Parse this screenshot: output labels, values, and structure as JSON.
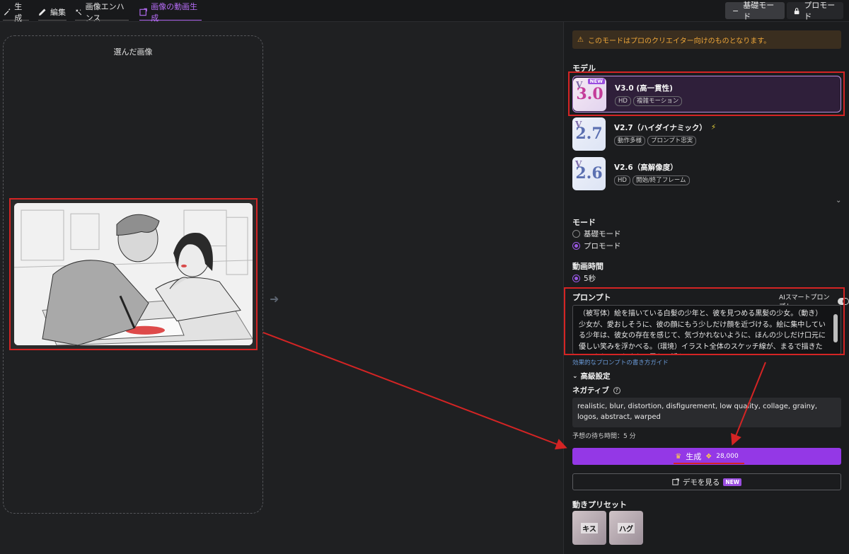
{
  "nav": {
    "tabs": [
      {
        "label": "生成",
        "icon": "brush-icon"
      },
      {
        "label": "編集",
        "icon": "pencil-icon"
      },
      {
        "label": "画像エンハンス",
        "icon": "magic-icon"
      },
      {
        "label": "画像の動画生成",
        "icon": "image-to-video-icon",
        "active": true
      }
    ],
    "mode_basic": "基礎モード",
    "mode_pro": "プロモード"
  },
  "left": {
    "title": "選んだ画像"
  },
  "right": {
    "warning": "このモードはプロのクリエイター向けのものとなります。",
    "model_label": "モデル",
    "models": [
      {
        "name": "V3.0 (高一貫性)",
        "thumb": "3.0",
        "badge": "NEW",
        "tags": [
          "HD",
          "複雑モーション"
        ],
        "selected": true
      },
      {
        "name": "V2.7（ハイダイナミック）",
        "thumb": "2.7",
        "tags": [
          "動作多様",
          "プロンプト忠実"
        ]
      },
      {
        "name": "V2.6（高解像度）",
        "thumb": "2.6",
        "tags": [
          "HD",
          "開始/終了フレーム"
        ]
      }
    ],
    "mode_label": "モード",
    "mode_options": [
      "基礎モード",
      "プロモード"
    ],
    "duration_label": "動画時間",
    "duration_value": "5秒",
    "prompt_label": "プロンプト",
    "ai_smart_prompt": "AIスマートプロンプト",
    "prompt_text": "（被写体）絵を描いている白髪の少年と、彼を見つめる黒髪の少女。（動き）少女が、愛おしそうに、彼の顔にもう少しだけ顔を近づける。絵に集中している少年は、彼女の存在を感じて、気づかれないように、ほんの少しだけ口元に優しい笑みを浮かべる。（環境）イラスト全体のスケッチ線が、まるで描きたてのように、かすかに震え、揺らぐ。",
    "prompt_guide": "効果的なプロンプトの書き方ガイド",
    "advanced": "高級設定",
    "negative_label": "ネガティブ",
    "negative_text": "realistic, blur, distortion, disfigurement, low quality, collage, grainy, logos, abstract, warped",
    "wait_time": "予想の待ち時間：5 分",
    "generate_label": "生成",
    "generate_cost": "28,000",
    "demo_label": "デモを見る",
    "demo_badge": "NEW",
    "presets_label": "動きプリセット",
    "presets": [
      "キス",
      "ハグ"
    ]
  },
  "colors": {
    "accent": "#9438e6",
    "annotation": "#d42424",
    "warning": "#f0a83a"
  }
}
